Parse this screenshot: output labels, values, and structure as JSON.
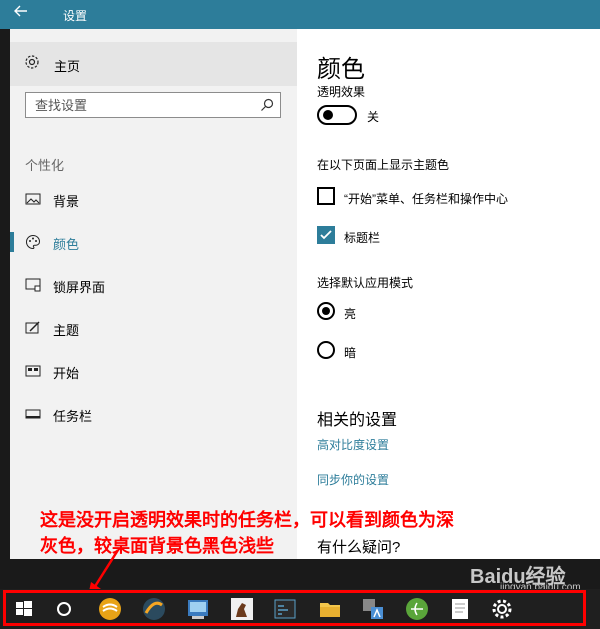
{
  "title_bar": {
    "back_icon": "back-arrow-icon",
    "title": "设置"
  },
  "sidebar": {
    "home_label": "主页",
    "search_placeholder": "查找设置",
    "section_title": "个性化",
    "items": [
      {
        "label": "背景",
        "icon": "picture-icon"
      },
      {
        "label": "颜色",
        "icon": "palette-icon",
        "active": true
      },
      {
        "label": "锁屏界面",
        "icon": "lock-screen-icon"
      },
      {
        "label": "主题",
        "icon": "theme-icon"
      },
      {
        "label": "开始",
        "icon": "start-icon"
      },
      {
        "label": "任务栏",
        "icon": "taskbar-icon"
      }
    ]
  },
  "content": {
    "title": "颜色",
    "transparency_label": "透明效果",
    "transparency_state": "关",
    "show_accent_heading": "在以下页面上显示主题色",
    "checkbox_start": "“开始”菜单、任务栏和操作中心",
    "checkbox_start_checked": false,
    "checkbox_titlebar": "标题栏",
    "checkbox_titlebar_checked": true,
    "app_mode_heading": "选择默认应用模式",
    "radio_light": "亮",
    "radio_dark": "暗",
    "radio_selected": "亮",
    "related_heading": "相关的设置",
    "link_high_contrast": "高对比度设置",
    "link_sync": "同步你的设置",
    "question": "有什么疑问?"
  },
  "annotation": {
    "line1": "这是没开启透明效果时的任务栏，可以看到颜色为深",
    "line2": "灰色，较桌面背景色黑色浅些"
  },
  "watermark": {
    "text": "Baidu经验",
    "sub": "jingyan.baidu.com"
  },
  "taskbar": {
    "icons": [
      "windows-start-icon",
      "cortana-circle-icon",
      "browser-icon",
      "app-icon",
      "image-viewer-icon",
      "app-horse-icon",
      "terminal-icon",
      "file-explorer-icon",
      "translate-icon",
      "internet-icon",
      "notepad-icon",
      "settings-gear-icon"
    ]
  },
  "colors": {
    "accent": "#2d7d9a",
    "annotation": "#ff0000",
    "taskbar": "#1f1f1f"
  }
}
